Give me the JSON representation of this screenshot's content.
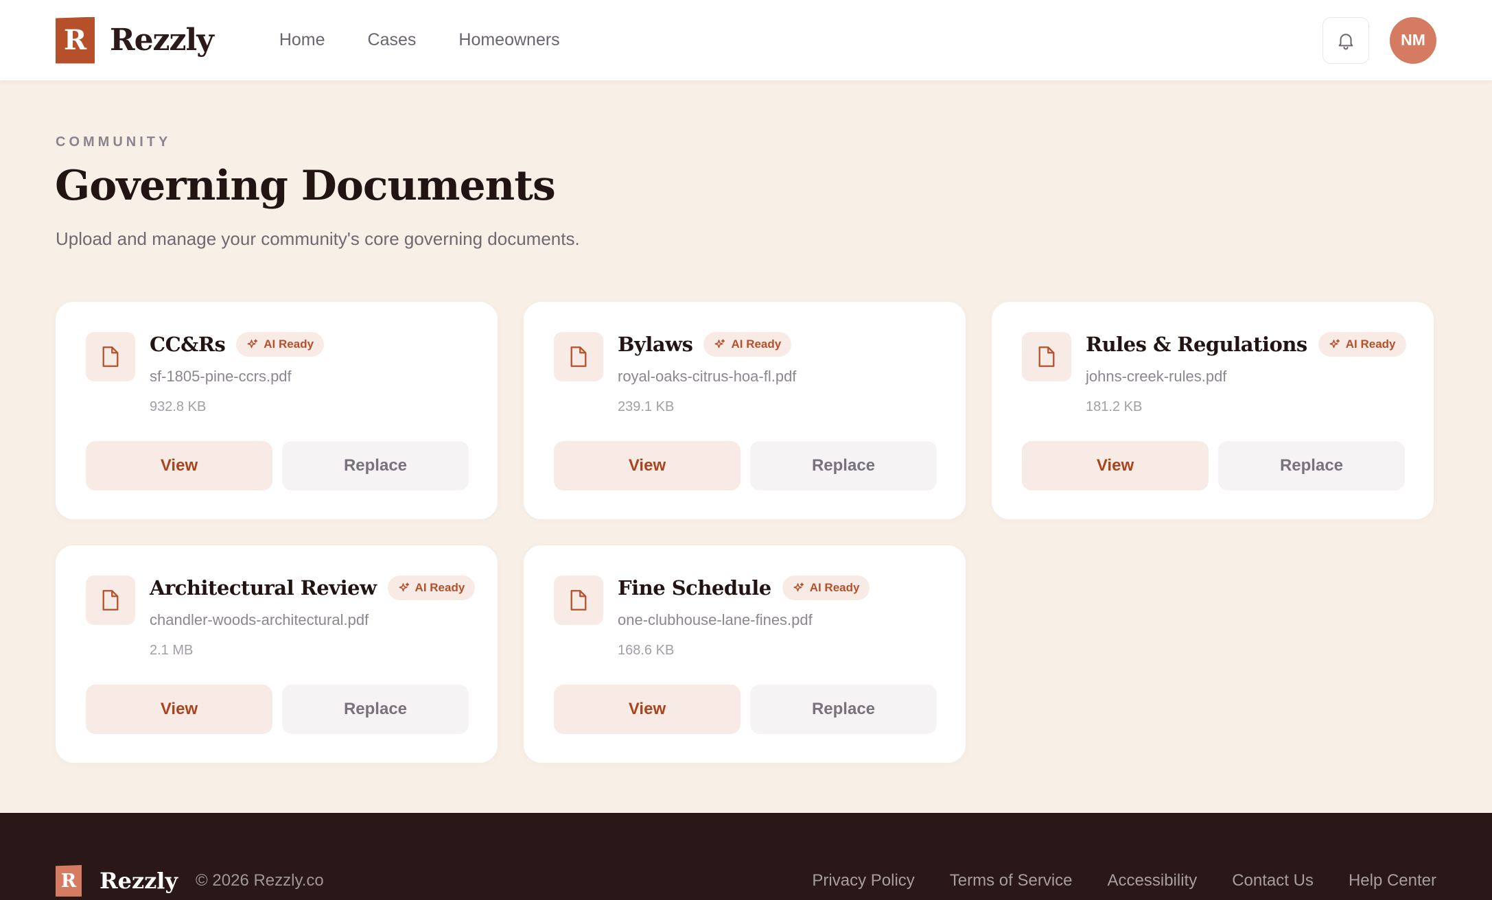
{
  "header": {
    "logo_letter": "R",
    "brand": "Rezzly",
    "nav": [
      "Home",
      "Cases",
      "Homeowners"
    ],
    "avatar_initials": "NM",
    "icons": [
      "bell-icon"
    ]
  },
  "page": {
    "eyebrow": "COMMUNITY",
    "title": "Governing Documents",
    "subtitle": "Upload and manage your community's core governing documents."
  },
  "documents": [
    {
      "title": "CC&Rs",
      "badge": "AI Ready",
      "file": "sf-1805-pine-ccrs.pdf",
      "size": "932.8 KB",
      "view": "View",
      "replace": "Replace"
    },
    {
      "title": "Bylaws",
      "badge": "AI Ready",
      "file": "royal-oaks-citrus-hoa-fl.pdf",
      "size": "239.1 KB",
      "view": "View",
      "replace": "Replace"
    },
    {
      "title": "Rules & Regulations",
      "badge": "AI Ready",
      "file": "johns-creek-rules.pdf",
      "size": "181.2 KB",
      "view": "View",
      "replace": "Replace"
    },
    {
      "title": "Architectural Review",
      "badge": "AI Ready",
      "file": "chandler-woods-architectural.pdf",
      "size": "2.1 MB",
      "view": "View",
      "replace": "Replace"
    },
    {
      "title": "Fine Schedule",
      "badge": "AI Ready",
      "file": "one-clubhouse-lane-fines.pdf",
      "size": "168.6 KB",
      "view": "View",
      "replace": "Replace"
    }
  ],
  "footer": {
    "logo_letter": "R",
    "brand": "Rezzly",
    "copyright": "© 2026 Rezzly.co",
    "links": [
      "Privacy Policy",
      "Terms of Service",
      "Accessibility",
      "Contact Us",
      "Help Center"
    ]
  },
  "colors": {
    "accent": "#b5502a",
    "background": "#f8f0e7",
    "footer": "#2a1718",
    "avatar": "#d47b62"
  }
}
